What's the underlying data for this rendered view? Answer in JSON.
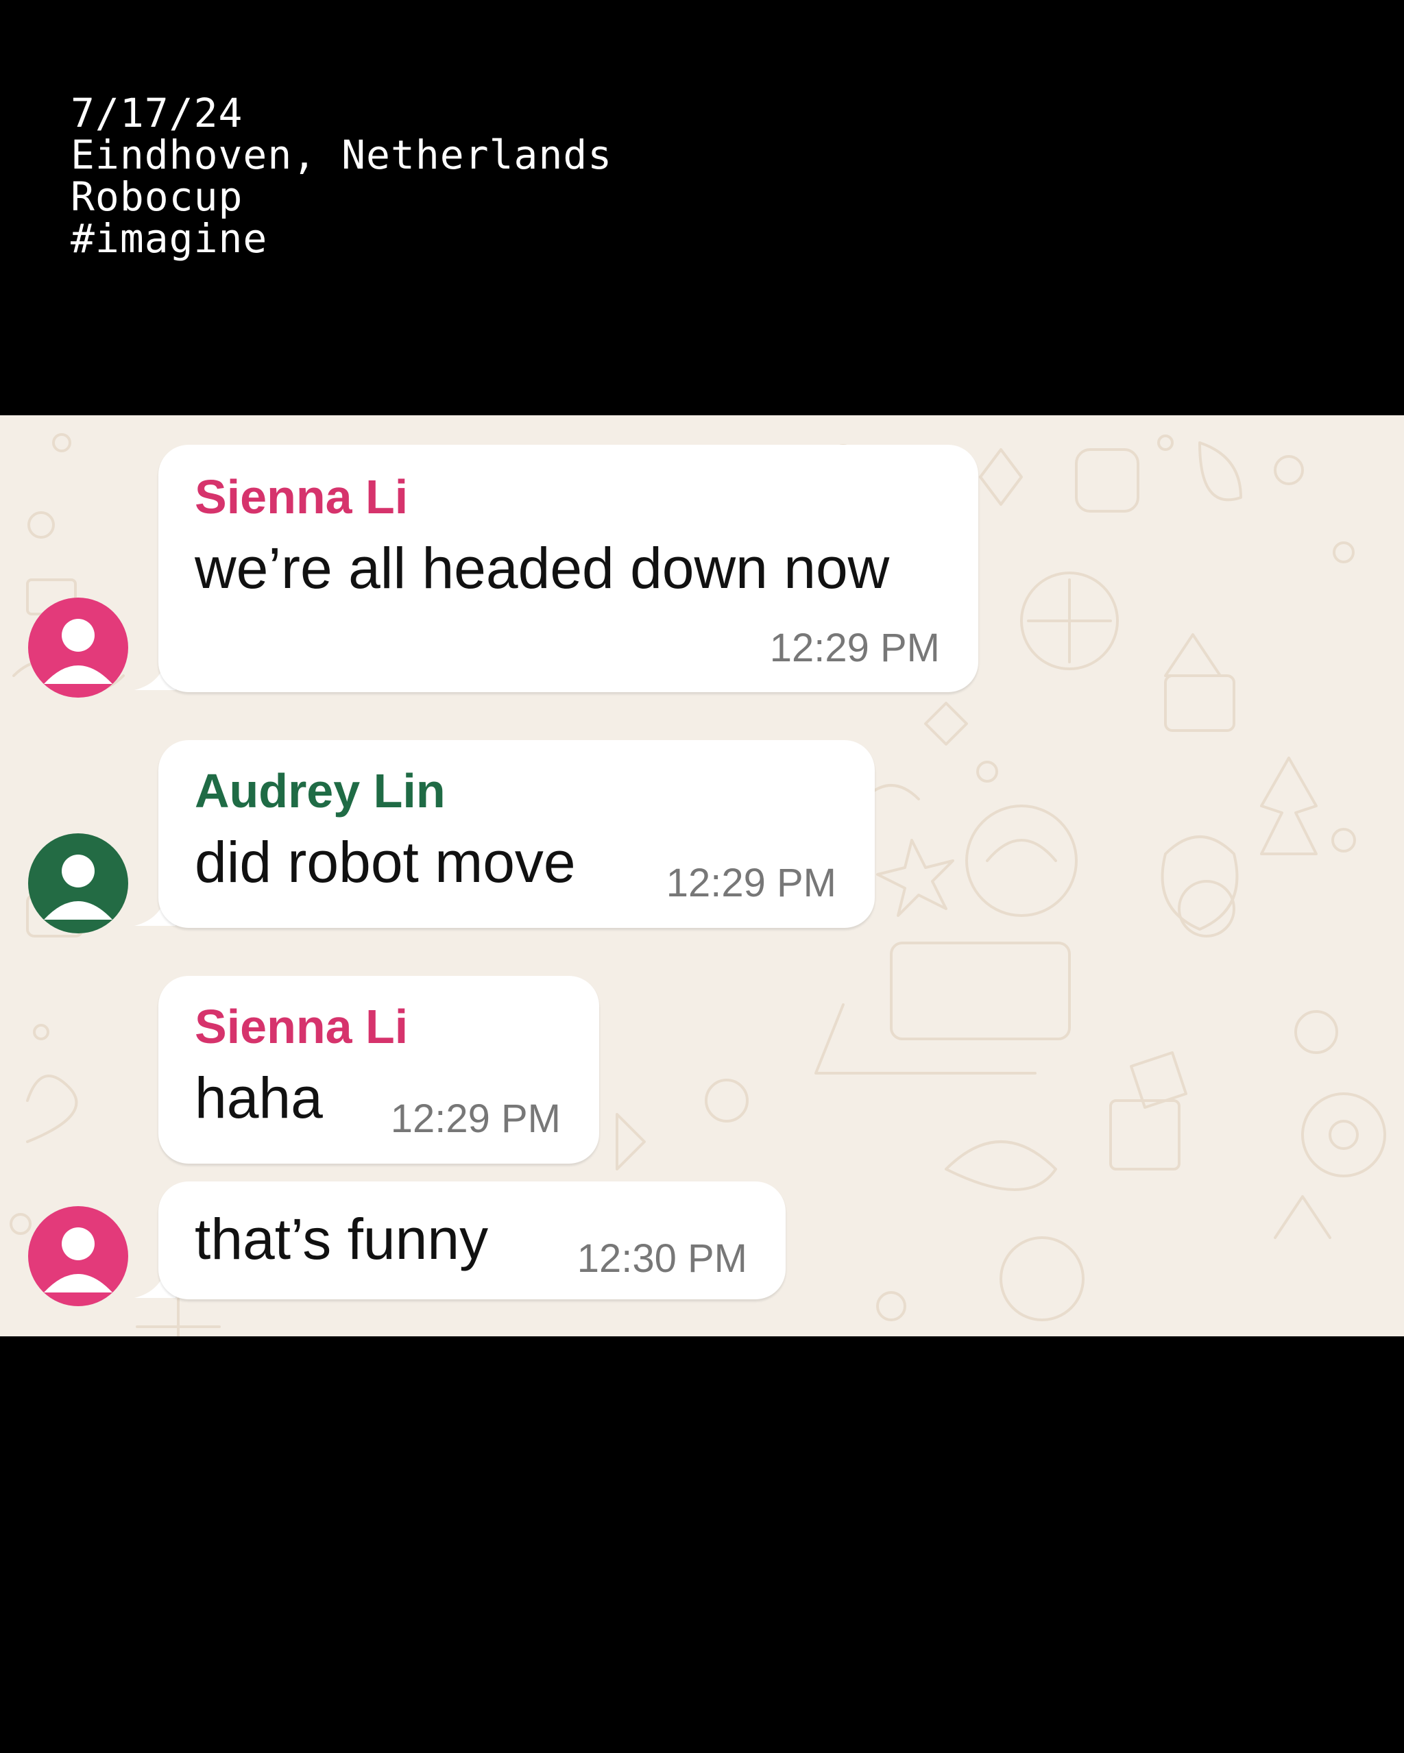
{
  "caption": {
    "lines": [
      "7/17/24",
      "Eindhoven, Netherlands",
      "Robocup",
      "#imagine"
    ]
  },
  "colors": {
    "sienna": "#d6336c",
    "audrey": "#1f6b45",
    "sienna_avatar": "#e33a7a",
    "audrey_avatar": "#236b44",
    "chat_bg": "#f4eee6",
    "doodle": "#e8dccd"
  },
  "messages": [
    {
      "sender": "Sienna Li",
      "text": "we’re all headed down now",
      "time": "12:29 PM",
      "avatar_icon": "person-icon"
    },
    {
      "sender": "Audrey Lin",
      "text": "did robot move",
      "time": "12:29 PM",
      "avatar_icon": "person-icon"
    },
    {
      "sender": "Sienna Li",
      "text": "haha",
      "time": "12:29 PM",
      "avatar_icon": "person-icon"
    },
    {
      "sender": "",
      "text": "that’s funny",
      "time": "12:30 PM",
      "avatar_icon": "person-icon"
    }
  ]
}
